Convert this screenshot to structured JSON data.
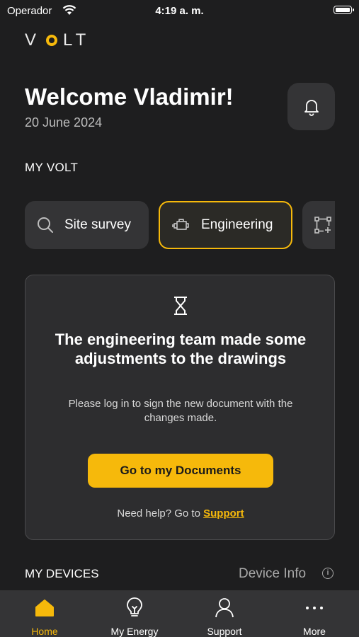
{
  "status_bar": {
    "carrier": "Operador",
    "time": "4:19 a. m."
  },
  "brand": {
    "logo_left": "V",
    "logo_right": "LT"
  },
  "header": {
    "welcome": "Welcome Vladimir!",
    "date": "20 June 2024"
  },
  "my_volt": {
    "label": "MY VOLT",
    "tabs": [
      {
        "label": "Site survey",
        "icon": "search-icon"
      },
      {
        "label": "Engineering",
        "icon": "engine-icon",
        "active": true
      },
      {
        "label": "",
        "icon": "bounding-box-add-icon"
      }
    ]
  },
  "card": {
    "icon": "hourglass-icon",
    "title": "The engineering team made some adjustments to the drawings",
    "body": "Please log in to sign the new document with the changes made.",
    "cta_label": "Go to my Documents",
    "help_prefix": "Need help? Go to ",
    "help_link": "Support"
  },
  "devices": {
    "label": "MY DEVICES",
    "info_label": "Device Info"
  },
  "bottom_nav": {
    "items": [
      {
        "label": "Home",
        "icon": "home-icon",
        "active": true
      },
      {
        "label": "My Energy",
        "icon": "lightbulb-icon"
      },
      {
        "label": "Support",
        "icon": "user-icon"
      },
      {
        "label": "More",
        "icon": "more-dots-icon"
      }
    ]
  },
  "colors": {
    "background": "#1e1e1f",
    "surface": "#343436",
    "accent": "#f6b90b"
  }
}
